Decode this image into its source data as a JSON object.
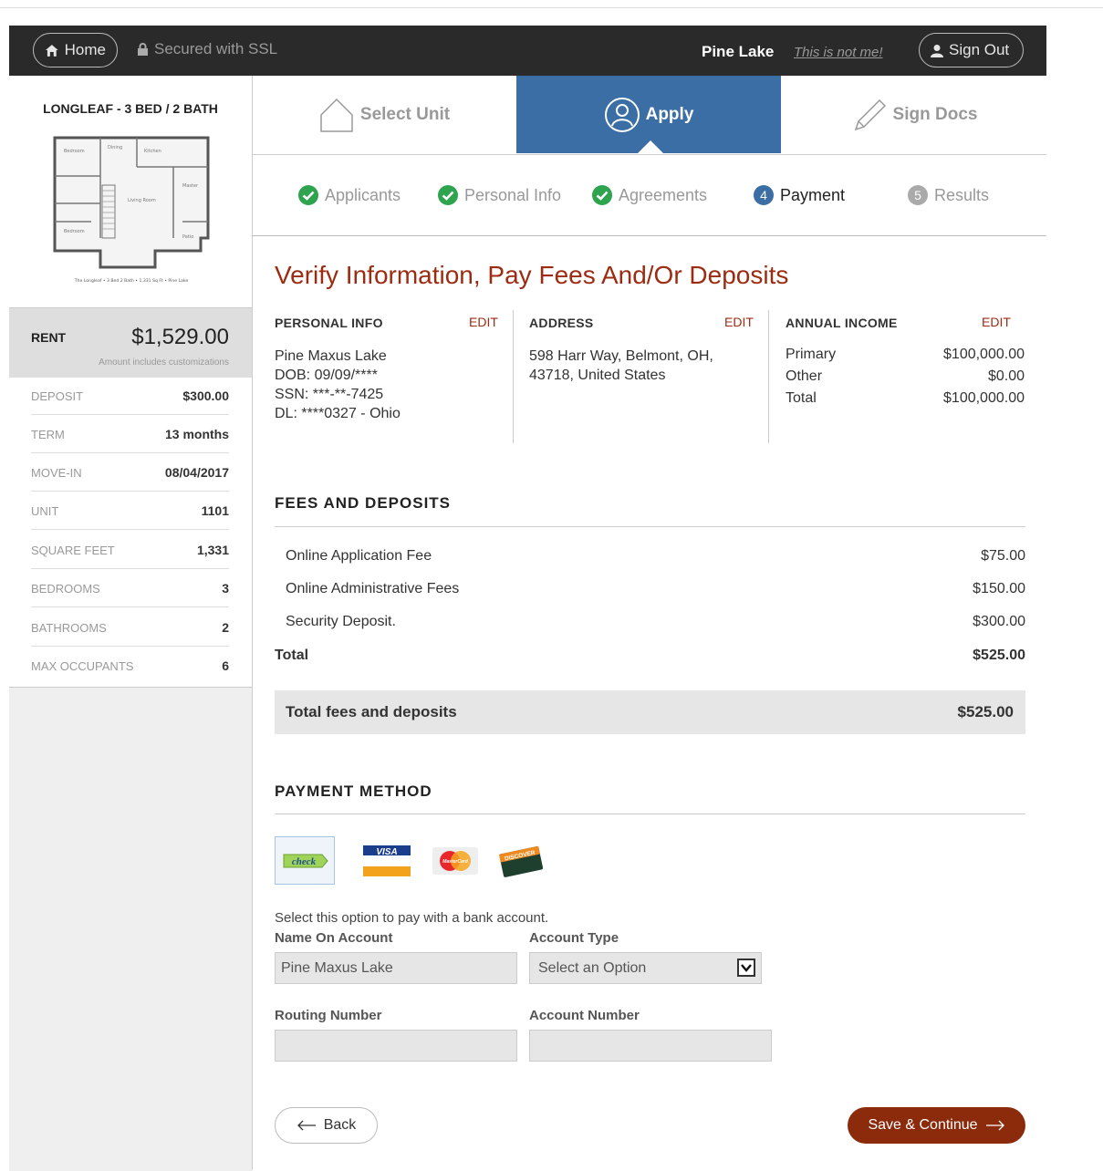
{
  "header": {
    "home_label": "Home",
    "ssl_label": "Secured with SSL",
    "property_name": "Pine Lake",
    "not_me_label": "This is not me!",
    "sign_out_label": "Sign Out"
  },
  "sidebar": {
    "unit_title": "LONGLEAF - 3 BED / 2 BATH",
    "floorplan_caption": "The Longleaf • 3 Bed 2 Bath • 1,331 Sq Ft • Pine Lake",
    "rent_label": "RENT",
    "rent_value": "$1,529.00",
    "rent_note": "Amount includes customizations",
    "details": [
      {
        "label": "DEPOSIT",
        "value": "$300.00"
      },
      {
        "label": "TERM",
        "value": "13 months"
      },
      {
        "label": "MOVE-IN",
        "value": "08/04/2017"
      },
      {
        "label": "UNIT",
        "value": "1101"
      },
      {
        "label": "SQUARE FEET",
        "value": "1,331"
      },
      {
        "label": "BEDROOMS",
        "value": "3"
      },
      {
        "label": "BATHROOMS",
        "value": "2"
      },
      {
        "label": "MAX OCCUPANTS",
        "value": "6"
      }
    ]
  },
  "steps": [
    {
      "label": "Select Unit",
      "icon": "house-icon"
    },
    {
      "label": "Apply",
      "icon": "user-circle-icon"
    },
    {
      "label": "Sign Docs",
      "icon": "pencil-icon"
    }
  ],
  "substeps": [
    {
      "label": "Applicants",
      "status": "done"
    },
    {
      "label": "Personal Info",
      "status": "done"
    },
    {
      "label": "Agreements",
      "status": "done"
    },
    {
      "label": "Payment",
      "number": "4",
      "status": "current"
    },
    {
      "label": "Results",
      "number": "5",
      "status": "pending"
    }
  ],
  "content": {
    "page_title": "Verify Information, Pay Fees And/Or Deposits",
    "edit_label": "EDIT",
    "personal": {
      "heading": "PERSONAL INFO",
      "name": "Pine Maxus Lake",
      "dob": "DOB: 09/09/****",
      "ssn": "SSN: ***-**-7425",
      "dl": "DL: ****0327 - Ohio"
    },
    "address": {
      "heading": "ADDRESS",
      "line1": "598 Harr Way, Belmont, OH,",
      "line2": "43718, United States"
    },
    "income": {
      "heading": "ANNUAL INCOME",
      "rows": [
        {
          "label": "Primary",
          "value": "$100,000.00"
        },
        {
          "label": "Other",
          "value": "$0.00"
        },
        {
          "label": "Total",
          "value": "$100,000.00"
        }
      ]
    },
    "fees": {
      "heading": "FEES AND DEPOSITS",
      "rows": [
        {
          "label": "Online Application Fee",
          "value": "$75.00"
        },
        {
          "label": "Online Administrative Fees",
          "value": "$150.00"
        },
        {
          "label": "Security Deposit.",
          "value": "$300.00"
        }
      ],
      "total_label": "Total",
      "total_value": "$525.00",
      "box_label": "Total fees and deposits",
      "box_value": "$525.00"
    },
    "payment": {
      "heading": "PAYMENT METHOD",
      "options": {
        "check": "check",
        "visa": "VISA",
        "mastercard": "MasterCard",
        "discover": "DISCOVER"
      },
      "hint": "Select this option to pay with a bank account.",
      "name_label": "Name On Account",
      "name_value": "Pine Maxus Lake",
      "type_label": "Account Type",
      "type_value": "Select an Option",
      "routing_label": "Routing Number",
      "account_label": "Account Number"
    },
    "back_label": "Back",
    "save_label": "Save & Continue"
  },
  "colors": {
    "header_bg": "#2a2a2a",
    "accent_blue": "#3a6ea5",
    "brand_red": "#9b2c12",
    "check_green": "#2ea44f"
  }
}
